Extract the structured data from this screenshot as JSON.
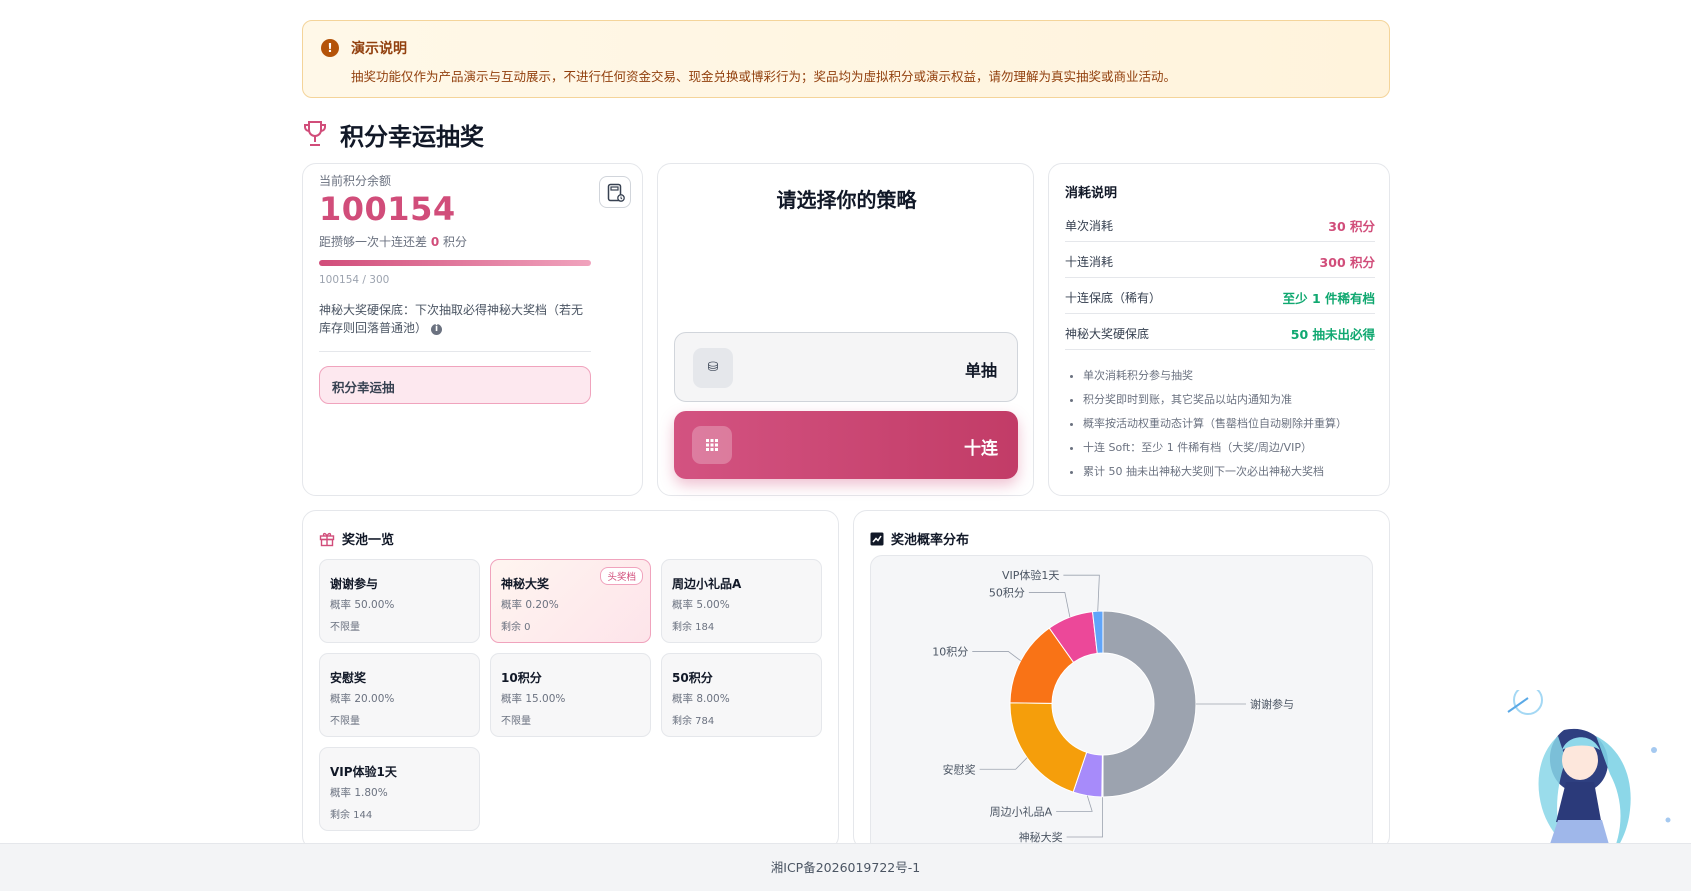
{
  "notice": {
    "title": "演示说明",
    "text": "抽奖功能仅作为产品演示与互动展示，不进行任何资金交易、现金兑换或博彩行为；奖品均为虚拟积分或演示权益，请勿理解为真实抽奖或商业活动。"
  },
  "page": {
    "title": "积分幸运抽奖"
  },
  "balance": {
    "label": "当前积分余额",
    "value": "100154",
    "gap_prefix": "距攒够一次十连还差",
    "gap_value": "0",
    "gap_suffix": "积分",
    "progress_text": "100154 / 300",
    "progress_fraction": 1.0,
    "guarantee_text": "神秘大奖硬保底：下次抽取必得神秘大奖档（若无库存则回落普通池）",
    "pool_label": "积分幸运抽"
  },
  "strategy": {
    "title": "请选择你的策略",
    "single_label": "单抽",
    "ten_label": "十连"
  },
  "costs": {
    "title": "消耗说明",
    "rows": [
      {
        "k": "单次消耗",
        "v": "30 积分",
        "color": "#d14d7a"
      },
      {
        "k": "十连消耗",
        "v": "300 积分",
        "color": "#d14d7a"
      },
      {
        "k": "十连保底（稀有）",
        "v": "至少 1 件稀有档",
        "color": "#10a870"
      },
      {
        "k": "神秘大奖硬保底",
        "v": "50 抽未出必得",
        "color": "#10a870"
      }
    ],
    "notes": [
      "单次消耗积分参与抽奖",
      "积分奖即时到账，其它奖品以站内通知为准",
      "概率按活动权重动态计算（售罄档位自动剔除并重算）",
      "十连 Soft：至少 1 件稀有档（大奖/周边/VIP）",
      "累计 50 抽未出神秘大奖则下一次必出神秘大奖档"
    ]
  },
  "pool": {
    "title": "奖池一览",
    "items": [
      {
        "name": "谢谢参与",
        "prob": "概率 50.00%",
        "stock": "不限量",
        "tag": ""
      },
      {
        "name": "神秘大奖",
        "prob": "概率 0.20%",
        "stock": "剩余 0",
        "tag": "头奖档"
      },
      {
        "name": "周边小礼品A",
        "prob": "概率 5.00%",
        "stock": "剩余 184",
        "tag": ""
      },
      {
        "name": "安慰奖",
        "prob": "概率 20.00%",
        "stock": "不限量",
        "tag": ""
      },
      {
        "name": "10积分",
        "prob": "概率 15.00%",
        "stock": "不限量",
        "tag": ""
      },
      {
        "name": "50积分",
        "prob": "概率 8.00%",
        "stock": "剩余 784",
        "tag": ""
      },
      {
        "name": "VIP体验1天",
        "prob": "概率 1.80%",
        "stock": "剩余 144",
        "tag": ""
      }
    ]
  },
  "chart_data": {
    "type": "pie",
    "title": "奖池概率分布",
    "donut": true,
    "slices": [
      {
        "label": "谢谢参与",
        "value": 50.0,
        "color": "#9ca3af"
      },
      {
        "label": "神秘大奖",
        "value": 0.2,
        "color": "#6b8fd6"
      },
      {
        "label": "周边小礼品A",
        "value": 5.0,
        "color": "#a78bfa"
      },
      {
        "label": "安慰奖",
        "value": 20.0,
        "color": "#f59e0b"
      },
      {
        "label": "10积分",
        "value": 15.0,
        "color": "#f97316"
      },
      {
        "label": "50积分",
        "value": 8.0,
        "color": "#ec4899"
      },
      {
        "label": "VIP体验1天",
        "value": 1.8,
        "color": "#60a5fa"
      }
    ]
  },
  "footer": {
    "icp": "湘ICP备2026019722号-1"
  },
  "colors": {
    "accent": "#d14d7a",
    "success": "#10a870",
    "warning_bg": "#fff8e8"
  }
}
